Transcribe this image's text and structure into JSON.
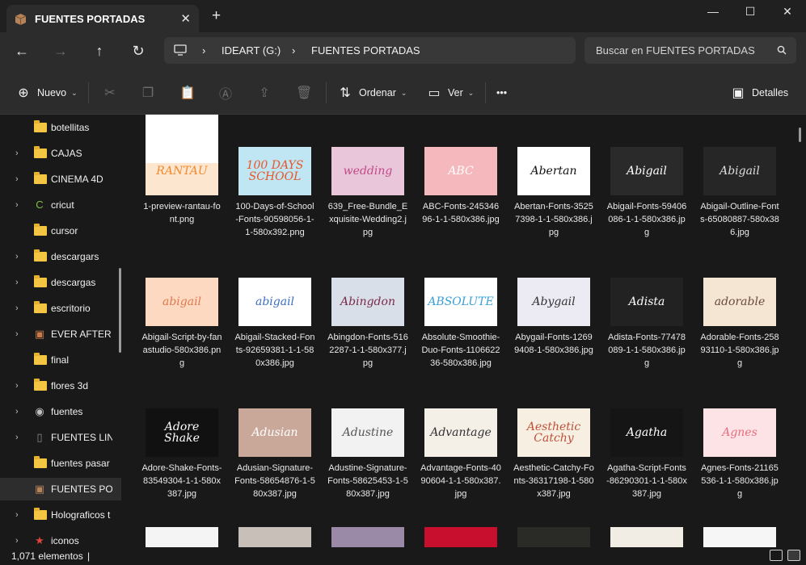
{
  "window": {
    "tab_title": "FUENTES PORTADAS",
    "tab_close": "✕",
    "new_tab": "+",
    "minimize": "—",
    "maximize": "☐",
    "close": "✕"
  },
  "nav": {
    "back": "←",
    "forward": "→",
    "up": "↑",
    "refresh": "↻",
    "breadcrumb": [
      "IDEART (G:)",
      "FUENTES PORTADAS"
    ],
    "separator": "›",
    "search_placeholder": "Buscar en FUENTES PORTADAS"
  },
  "toolbar": {
    "new_label": "Nuevo",
    "sort_label": "Ordenar",
    "view_label": "Ver",
    "more_label": "•••",
    "details_label": "Detalles"
  },
  "sidebar": {
    "items": [
      {
        "label": "botellitas",
        "chevron": false,
        "icon": "folder"
      },
      {
        "label": "CAJAS",
        "chevron": true,
        "icon": "folder"
      },
      {
        "label": "CINEMA 4D",
        "chevron": true,
        "icon": "folder"
      },
      {
        "label": "cricut",
        "chevron": true,
        "icon": "cricut-icon"
      },
      {
        "label": "cursor",
        "chevron": false,
        "icon": "folder"
      },
      {
        "label": "descargars",
        "chevron": true,
        "icon": "folder"
      },
      {
        "label": "descargas",
        "chevron": true,
        "icon": "folder"
      },
      {
        "label": "escritorio",
        "chevron": true,
        "icon": "folder"
      },
      {
        "label": "EVER AFTER",
        "chevron": true,
        "icon": "gift-box-icon"
      },
      {
        "label": "final",
        "chevron": false,
        "icon": "folder"
      },
      {
        "label": "flores 3d",
        "chevron": true,
        "icon": "folder"
      },
      {
        "label": "fuentes",
        "chevron": true,
        "icon": "eye-icon"
      },
      {
        "label": "FUENTES LINEA",
        "chevron": true,
        "icon": "blank-folder-icon"
      },
      {
        "label": "fuentes pasar",
        "chevron": false,
        "icon": "folder"
      },
      {
        "label": "FUENTES PORTADAS",
        "chevron": false,
        "icon": "box-icon",
        "selected": true
      },
      {
        "label": "Holograficos t",
        "chevron": true,
        "icon": "folder"
      },
      {
        "label": "iconos",
        "chevron": true,
        "icon": "star-icon"
      }
    ]
  },
  "files": [
    {
      "name": "1-preview-rantau-font.png",
      "thumb_text": "RANTAU",
      "bg": "#fde6cf",
      "fg": "#f28a2e"
    },
    {
      "name": "100-Days-of-School-Fonts-90598056-1-1-580x392.png",
      "thumb_text": "100 DAYS SCHOOL",
      "bg": "#bfe6f2",
      "fg": "#e8562a"
    },
    {
      "name": "639_Free-Bundle_Exquisite-Wedding2.jpg",
      "thumb_text": "wedding",
      "bg": "#e9c6d9",
      "fg": "#c04a8a"
    },
    {
      "name": "ABC-Fonts-24534696-1-1-580x386.jpg",
      "thumb_text": "ABC",
      "bg": "#f4b8bd",
      "fg": "#ffffff"
    },
    {
      "name": "Abertan-Fonts-35257398-1-1-580x386.jpg",
      "thumb_text": "Abertan",
      "bg": "#ffffff",
      "fg": "#111111"
    },
    {
      "name": "Abigail-Fonts-59406086-1-1-580x386.jpg",
      "thumb_text": "Abigail",
      "bg": "#2a2a2a",
      "fg": "#ffffff"
    },
    {
      "name": "Abigail-Outline-Fonts-65080887-580x386.jpg",
      "thumb_text": "Abigail",
      "bg": "#262626",
      "fg": "#dddddd"
    },
    {
      "name": "Abigail-Script-by-fanastudio-580x386.png",
      "thumb_text": "abigail",
      "bg": "#fdd9c2",
      "fg": "#e07a4e"
    },
    {
      "name": "Abigail-Stacked-Fonts-92659381-1-1-580x386.jpg",
      "thumb_text": "abigail",
      "bg": "#ffffff",
      "fg": "#3b6fc4"
    },
    {
      "name": "Abingdon-Fonts-5162287-1-1-580x377.jpg",
      "thumb_text": "Abingdon",
      "bg": "#d9dfe8",
      "fg": "#7a2a4a"
    },
    {
      "name": "Absolute-Smoothie-Duo-Fonts-110662236-580x386.jpg",
      "thumb_text": "ABSOLUTE",
      "bg": "#ffffff",
      "fg": "#3aa0d8"
    },
    {
      "name": "Abygail-Fonts-12699408-1-580x386.jpg",
      "thumb_text": "Abygail",
      "bg": "#ecebf4",
      "fg": "#333333"
    },
    {
      "name": "Adista-Fonts-77478089-1-1-580x386.jpg",
      "thumb_text": "Adista",
      "bg": "#222222",
      "fg": "#ffffff"
    },
    {
      "name": "Adorable-Fonts-25893110-1-580x386.jpg",
      "thumb_text": "adorable",
      "bg": "#f5e6d4",
      "fg": "#6a4a3a"
    },
    {
      "name": "Adore-Shake-Fonts-83549304-1-1-580x387.jpg",
      "thumb_text": "Adore Shake",
      "bg": "#111111",
      "fg": "#ffffff"
    },
    {
      "name": "Adusian-Signature-Fonts-58654876-1-580x387.jpg",
      "thumb_text": "Adusian",
      "bg": "#c9a89a",
      "fg": "#ffffff"
    },
    {
      "name": "Adustine-Signature-Fonts-58625453-1-580x387.jpg",
      "thumb_text": "Adustine",
      "bg": "#f2f2f2",
      "fg": "#555555"
    },
    {
      "name": "Advantage-Fonts-4090604-1-1-580x387.jpg",
      "thumb_text": "Advantage",
      "bg": "#f4efe7",
      "fg": "#333333"
    },
    {
      "name": "Aesthetic-Catchy-Fonts-36317198-1-580x387.jpg",
      "thumb_text": "Aesthetic Catchy",
      "bg": "#f6efe2",
      "fg": "#c0503a"
    },
    {
      "name": "Agatha-Script-Fonts-86290301-1-1-580x387.jpg",
      "thumb_text": "Agatha",
      "bg": "#151515",
      "fg": "#ffffff"
    },
    {
      "name": "Agnes-Fonts-21165536-1-1-580x386.jpg",
      "thumb_text": "Agnes",
      "bg": "#fde2e6",
      "fg": "#e4707e"
    },
    {
      "name": "",
      "thumb_text": "",
      "bg": "#f4f4f4",
      "fg": "#333333"
    },
    {
      "name": "",
      "thumb_text": "",
      "bg": "#c7bfb8",
      "fg": "#333333"
    },
    {
      "name": "",
      "thumb_text": "",
      "bg": "#9a8aa8",
      "fg": "#ffffff"
    },
    {
      "name": "",
      "thumb_text": "",
      "bg": "#c8102e",
      "fg": "#ffffff"
    },
    {
      "name": "",
      "thumb_text": "",
      "bg": "#2a2a26",
      "fg": "#ffffff"
    },
    {
      "name": "",
      "thumb_text": "",
      "bg": "#f1ede4",
      "fg": "#333333"
    },
    {
      "name": "",
      "thumb_text": "",
      "bg": "#f6f6f6",
      "fg": "#333333"
    },
    {
      "name": "",
      "thumb_text": "",
      "bg": "#ffffff",
      "fg": "#333333"
    }
  ],
  "status": {
    "count": "1,071 elementos",
    "divider": "|"
  }
}
